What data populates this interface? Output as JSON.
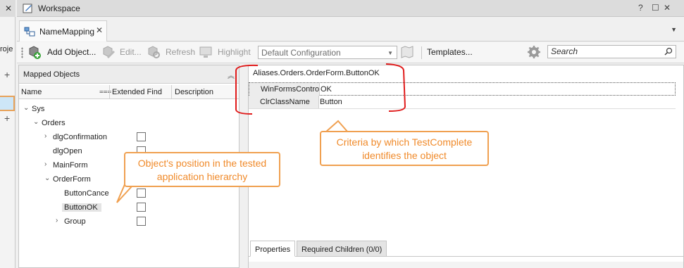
{
  "left_strip": {
    "close": "✕",
    "project_label": "roje"
  },
  "window": {
    "title": "Workspace",
    "help": "?",
    "restore": "☐",
    "close": "✕"
  },
  "tab": {
    "label": "NameMapping",
    "close": "✕"
  },
  "toolbar": {
    "add_object": "Add Object...",
    "edit": "Edit...",
    "refresh": "Refresh",
    "highlight": "Highlight",
    "configuration": "Default Configuration",
    "templates": "Templates...",
    "search_placeholder": "Search"
  },
  "mapped_objects": {
    "title": "Mapped Objects",
    "columns": [
      "Name",
      "Extended Find",
      "Description"
    ],
    "tree": [
      {
        "name": "Sys",
        "level": 0,
        "arrow": "⌄",
        "checkbox": false
      },
      {
        "name": "Orders",
        "level": 1,
        "arrow": "⌄",
        "checkbox": false
      },
      {
        "name": "dlgConfirmation",
        "level": 2,
        "arrow": "›",
        "checkbox": true
      },
      {
        "name": "dlgOpen",
        "level": 2,
        "arrow": "",
        "checkbox": true
      },
      {
        "name": "MainForm",
        "level": 2,
        "arrow": "›",
        "checkbox": true
      },
      {
        "name": "OrderForm",
        "level": 2,
        "arrow": "⌄",
        "checkbox": true
      },
      {
        "name": "ButtonCance",
        "level": 3,
        "arrow": "",
        "checkbox": true
      },
      {
        "name": "ButtonOK",
        "level": 3,
        "arrow": "",
        "checkbox": true,
        "selected": true
      },
      {
        "name": "Group",
        "level": 3,
        "arrow": "›",
        "checkbox": true
      }
    ]
  },
  "details": {
    "path": "Aliases.Orders.OrderForm.ButtonOK",
    "properties": [
      {
        "key": "WinFormsContro",
        "value": "OK"
      },
      {
        "key": "ClrClassName",
        "value": "Button"
      }
    ],
    "tabs": [
      "Properties",
      "Required Children (0/0)"
    ]
  },
  "annotations": {
    "criteria": "Criteria by which TestComplete identifies the object",
    "position": "Object's position in the tested application hierarchy"
  },
  "colors": {
    "callout_border": "#f0a050",
    "callout_text": "#f08a2a",
    "bracket": "#e01b1b"
  }
}
